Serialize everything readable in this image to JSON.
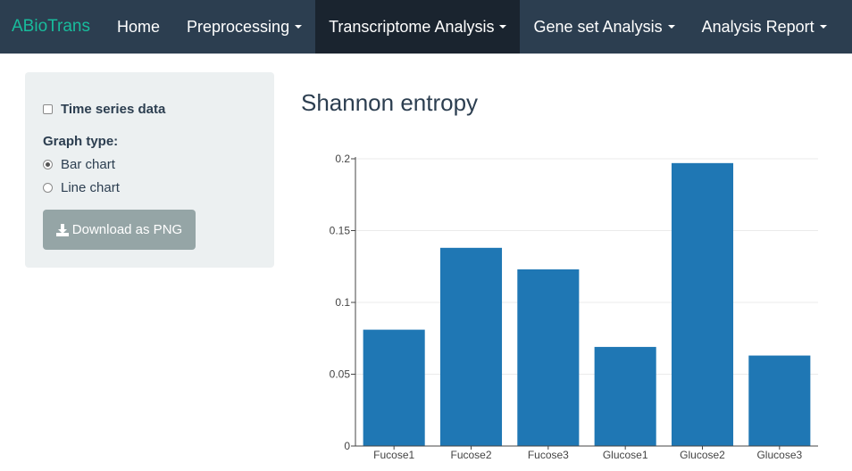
{
  "navbar": {
    "brand": "ABioTrans",
    "items": [
      {
        "label": "Home",
        "dropdown": false,
        "active": false
      },
      {
        "label": "Preprocessing",
        "dropdown": true,
        "active": false
      },
      {
        "label": "Transcriptome Analysis",
        "dropdown": true,
        "active": true
      },
      {
        "label": "Gene set Analysis",
        "dropdown": true,
        "active": false
      },
      {
        "label": "Analysis Report",
        "dropdown": true,
        "active": false
      }
    ]
  },
  "sidebar": {
    "time_series_label": "Time series data",
    "time_series_checked": false,
    "graph_type_label": "Graph type:",
    "graph_options": [
      {
        "label": "Bar chart",
        "selected": true
      },
      {
        "label": "Line chart",
        "selected": false
      }
    ],
    "download_label": "Download as PNG"
  },
  "main": {
    "title": "Shannon entropy"
  },
  "colors": {
    "navbar_bg": "#2c3e50",
    "navbar_active_bg": "#1a242f",
    "brand": "#18bc9c",
    "bar": "#1f77b4",
    "sidebar_bg": "#ecf0f1",
    "button_bg": "#95a5a6"
  },
  "chart_data": {
    "type": "bar",
    "categories": [
      "Fucose1",
      "Fucose2",
      "Fucose3",
      "Glucose1",
      "Glucose2",
      "Glucose3"
    ],
    "values": [
      0.081,
      0.138,
      0.123,
      0.069,
      0.197,
      0.063
    ],
    "yticks": [
      "0",
      "0.05",
      "0.1",
      "0.15",
      "0.2"
    ],
    "ytick_values": [
      0,
      0.05,
      0.1,
      0.15,
      0.2
    ],
    "ylim": [
      0,
      0.2
    ],
    "grid": true,
    "title": "",
    "xlabel": "",
    "ylabel": ""
  }
}
